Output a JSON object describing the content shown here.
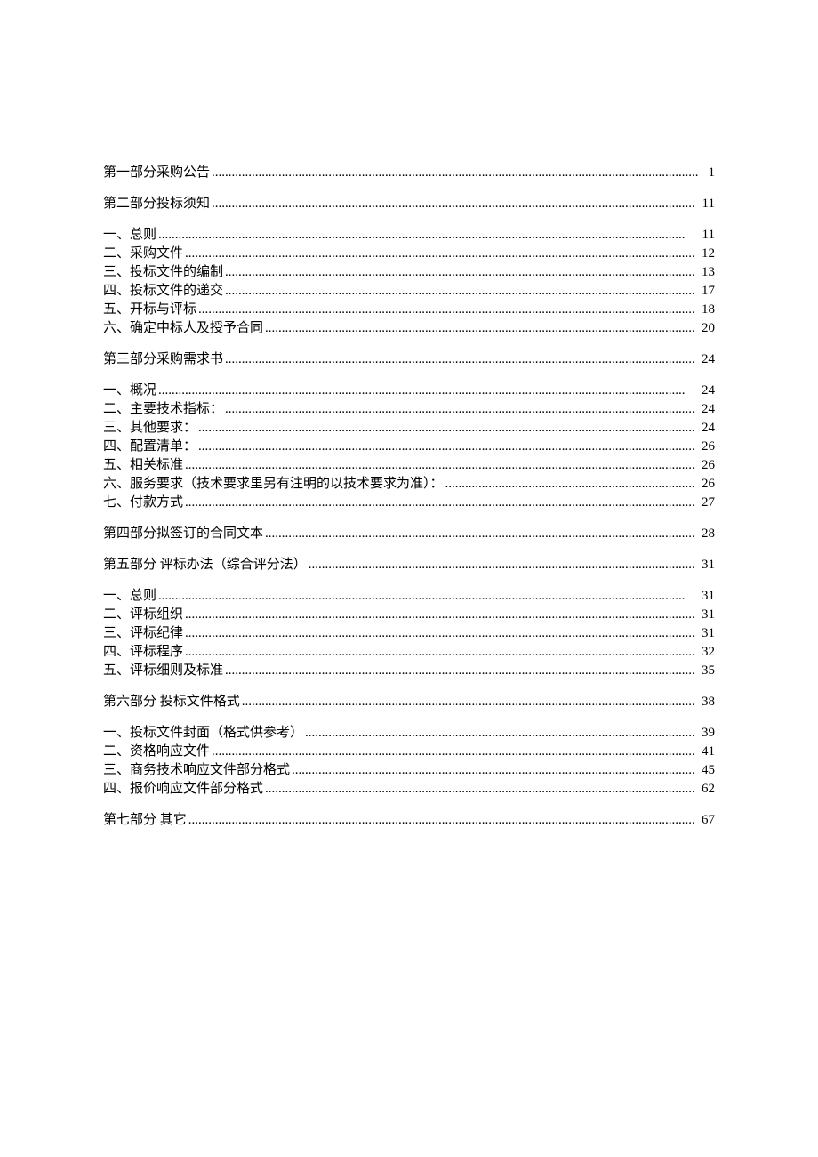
{
  "toc": [
    {
      "level": 1,
      "title": "第一部分采购公告",
      "page": "1",
      "spaceBefore": true
    },
    {
      "level": 1,
      "title": "第二部分投标须知",
      "page": "11",
      "spaceBefore": true
    },
    {
      "level": 2,
      "title": "一、总则",
      "page": "11"
    },
    {
      "level": 2,
      "title": "二、采购文件",
      "page": "12"
    },
    {
      "level": 2,
      "title": "三、投标文件的编制",
      "page": "13"
    },
    {
      "level": 2,
      "title": "四、投标文件的递交",
      "page": "17"
    },
    {
      "level": 2,
      "title": "五、开标与评标",
      "page": "18"
    },
    {
      "level": 2,
      "title": "六、确定中标人及授予合同",
      "page": "20"
    },
    {
      "level": 1,
      "title": "第三部分采购需求书",
      "page": "24",
      "spaceBefore": true
    },
    {
      "level": 2,
      "title": "一、概况",
      "page": "24"
    },
    {
      "level": 2,
      "title": "二、主要技术指标：",
      "page": "24",
      "spaceBefore": true
    },
    {
      "level": 2,
      "title": "三、其他要求：",
      "page": "24",
      "spaceBefore": true
    },
    {
      "level": 2,
      "title": "四、配置清单：",
      "page": "26",
      "spaceBefore": true
    },
    {
      "level": 2,
      "title": "五、相关标准",
      "page": "26"
    },
    {
      "level": 2,
      "title": "六、服务要求（技术要求里另有注明的以技术要求为准）：",
      "page": "26",
      "spaceBefore": true
    },
    {
      "level": 2,
      "title": "七、付款方式",
      "page": "27"
    },
    {
      "level": 1,
      "title": "第四部分拟签订的合同文本",
      "page": "28",
      "spaceBefore": true
    },
    {
      "level": 1,
      "title": "第五部分 评标办法（综合评分法）",
      "page": "31",
      "spaceBefore": true
    },
    {
      "level": 2,
      "title": "一、总则",
      "page": "31"
    },
    {
      "level": 2,
      "title": "二、评标组织",
      "page": "31"
    },
    {
      "level": 2,
      "title": "三、评标纪律",
      "page": "31"
    },
    {
      "level": 2,
      "title": "四、评标程序",
      "page": "32"
    },
    {
      "level": 2,
      "title": "五、评标细则及标准",
      "page": "35"
    },
    {
      "level": 1,
      "title": "第六部分 投标文件格式",
      "page": "38",
      "spaceBefore": true
    },
    {
      "level": 2,
      "title": "一、投标文件封面（格式供参考）",
      "page": "39",
      "spaceBefore": true
    },
    {
      "level": 2,
      "title": "二、资格响应文件",
      "page": "41"
    },
    {
      "level": 2,
      "title": "三、商务技术响应文件部分格式",
      "page": "45"
    },
    {
      "level": 2,
      "title": "四、报价响应文件部分格式",
      "page": "62"
    },
    {
      "level": 1,
      "title": "第七部分 其它",
      "page": "67",
      "spaceBefore": true
    }
  ]
}
